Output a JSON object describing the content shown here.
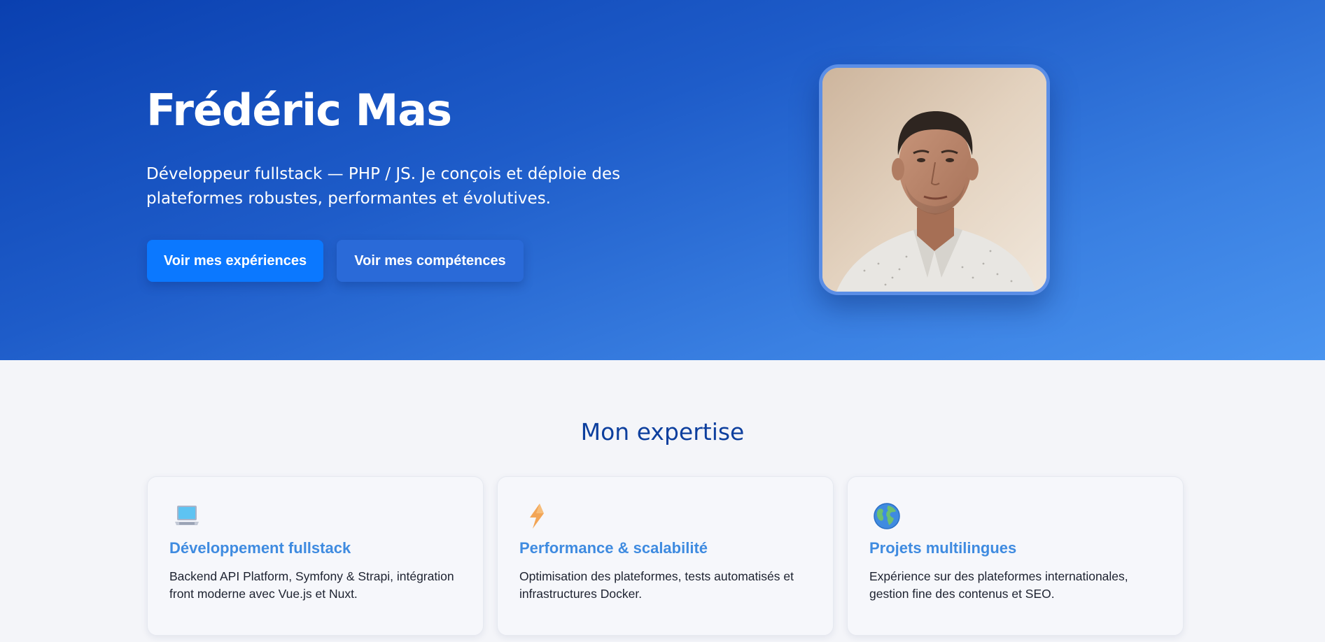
{
  "hero": {
    "name": "Frédéric Mas",
    "tagline": "Développeur fullstack — PHP / JS. Je conçois et déploie des plateformes robustes, performantes et évolutives.",
    "primary_button": "Voir mes expériences",
    "secondary_button": "Voir mes compétences"
  },
  "expertise": {
    "title": "Mon expertise",
    "cards": [
      {
        "icon": "laptop-icon",
        "title": "Développement fullstack",
        "description": "Backend API Platform, Symfony & Strapi, intégration front moderne avec Vue.js et Nuxt."
      },
      {
        "icon": "lightning-icon",
        "title": "Performance & scalabilité",
        "description": "Optimisation des plateformes, tests automatisés et infrastructures Docker."
      },
      {
        "icon": "globe-icon",
        "title": "Projets multilingues",
        "description": "Expérience sur des plateformes internationales, gestion fine des contenus et SEO."
      }
    ]
  },
  "colors": {
    "hero_gradient_start": "#0a40b0",
    "hero_gradient_end": "#4a94ef",
    "primary_button": "#0b78ff",
    "secondary_button": "#2a6ad8",
    "section_title": "#0d3f9e",
    "card_title": "#3f8be0"
  }
}
